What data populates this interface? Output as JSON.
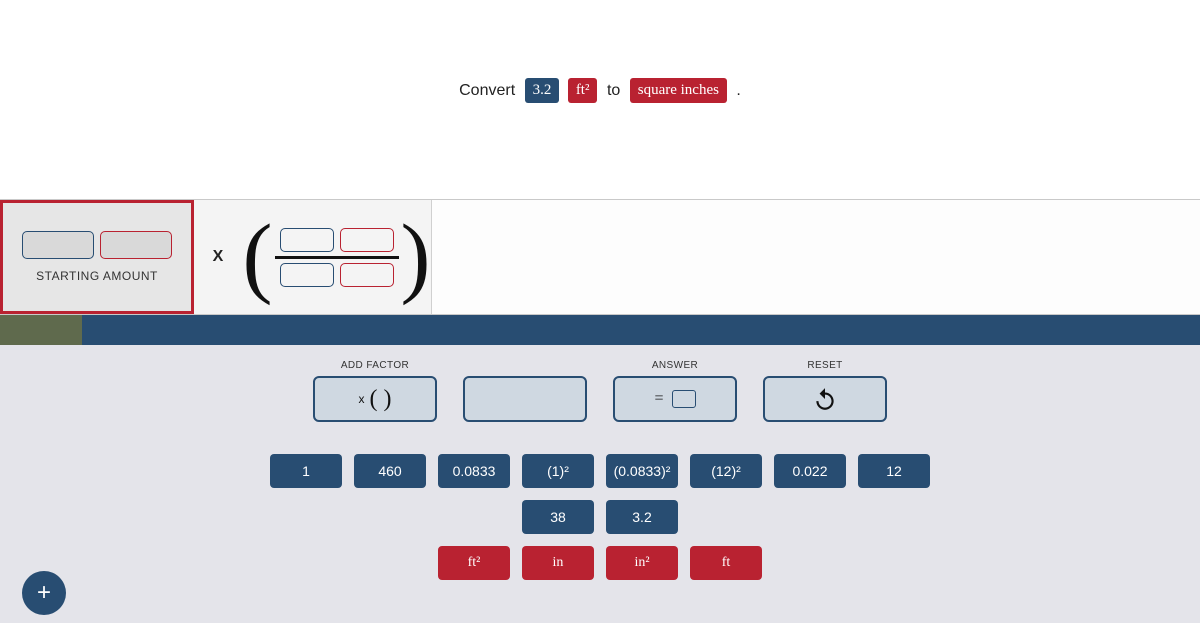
{
  "prompt": {
    "word_convert": "Convert",
    "value": "3.2",
    "from_unit": "ft²",
    "word_to": "to",
    "to_unit": "square inches",
    "trailing": "."
  },
  "starting": {
    "label": "STARTING AMOUNT"
  },
  "times_symbol": "X",
  "controls": {
    "add_factor": {
      "label": "ADD FACTOR",
      "display_left": "x",
      "display_parens": "(   )"
    },
    "blank": {
      "label": ""
    },
    "answer": {
      "label": "ANSWER",
      "eq": "="
    },
    "reset": {
      "label": "RESET"
    }
  },
  "tiles": {
    "row1": [
      "1",
      "460",
      "0.0833",
      "(1)²",
      "(0.0833)²",
      "(12)²",
      "0.022",
      "12"
    ],
    "row2": [
      "38",
      "3.2"
    ],
    "row3": [
      "ft²",
      "in",
      "in²",
      "ft"
    ]
  },
  "fab": "+"
}
